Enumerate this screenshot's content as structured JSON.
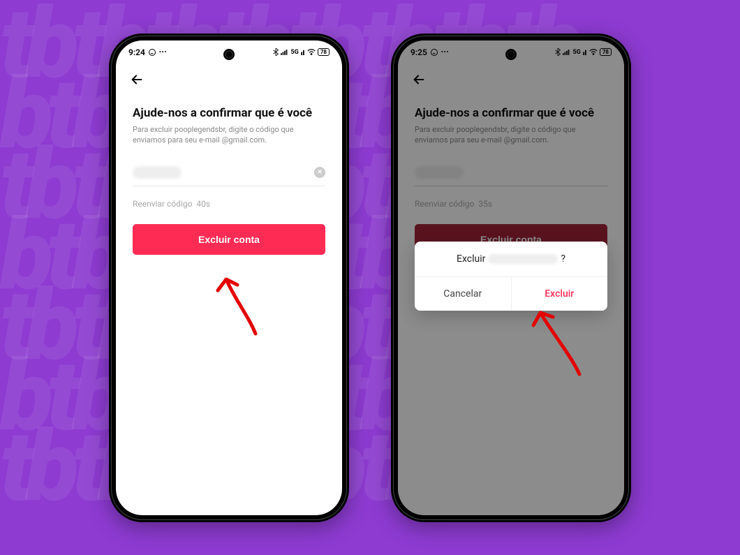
{
  "phone1": {
    "status": {
      "time": "9:24",
      "network_label": "5G",
      "battery_label": "78"
    },
    "title": "Ajude-nos a confirmar que é você",
    "subtitle_prefix": "Para excluir pooplegendsbr, digite o código que enviamos para seu e-mail ",
    "subtitle_suffix": "@gmail.com.",
    "resend_label": "Reenviar código",
    "resend_timer": "40s",
    "primary_button": "Excluir conta"
  },
  "phone2": {
    "status": {
      "time": "9:25",
      "network_label": "5G",
      "battery_label": "78"
    },
    "title": "Ajude-nos a confirmar que é você",
    "subtitle_prefix": "Para excluir pooplegendsbr, digite o código que enviamos para seu e-mail ",
    "subtitle_suffix": "@gmail.com.",
    "resend_label": "Reenviar código",
    "resend_timer": "35s",
    "primary_button": "Excluir conta",
    "dialog": {
      "title_prefix": "Excluir",
      "title_suffix": "?",
      "cancel": "Cancelar",
      "delete": "Excluir"
    }
  }
}
